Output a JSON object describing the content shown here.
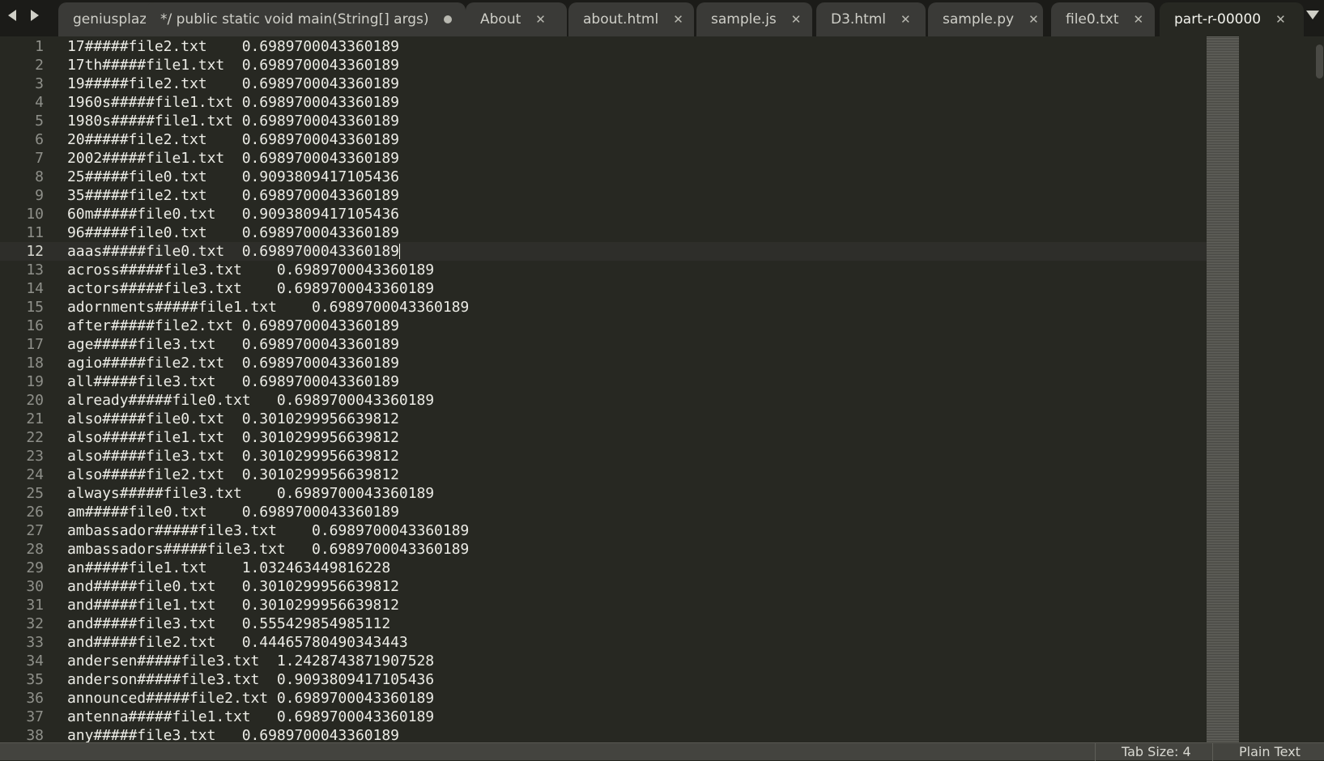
{
  "tabs": [
    {
      "label": "geniusplaz",
      "state": "truncated"
    },
    {
      "label": "*/    public static void main(String[] args)",
      "state": "modified"
    },
    {
      "label": "About",
      "state": "close"
    },
    {
      "label": "about.html",
      "state": "close"
    },
    {
      "label": "sample.js",
      "state": "close"
    },
    {
      "label": "D3.html",
      "state": "close"
    },
    {
      "label": "sample.py",
      "state": "close"
    },
    {
      "label": "file0.txt",
      "state": "close"
    },
    {
      "label": "part-r-00000",
      "state": "close",
      "active": true
    }
  ],
  "icons": {
    "back": "chevron-left-icon",
    "forward": "chevron-right-icon",
    "close": "close-icon",
    "modified": "unsaved-dot-icon",
    "tab_list": "chevron-down-icon"
  },
  "editor": {
    "current_line": 12,
    "lines": [
      "17#####file2.txt    0.6989700043360189",
      "17th#####file1.txt  0.6989700043360189",
      "19#####file2.txt    0.6989700043360189",
      "1960s#####file1.txt 0.6989700043360189",
      "1980s#####file1.txt 0.6989700043360189",
      "20#####file2.txt    0.6989700043360189",
      "2002#####file1.txt  0.6989700043360189",
      "25#####file0.txt    0.9093809417105436",
      "35#####file2.txt    0.6989700043360189",
      "60m#####file0.txt   0.9093809417105436",
      "96#####file0.txt    0.6989700043360189",
      "aaas#####file0.txt  0.6989700043360189",
      "across#####file3.txt    0.6989700043360189",
      "actors#####file3.txt    0.6989700043360189",
      "adornments#####file1.txt    0.6989700043360189",
      "after#####file2.txt 0.6989700043360189",
      "age#####file3.txt   0.6989700043360189",
      "agio#####file2.txt  0.6989700043360189",
      "all#####file3.txt   0.6989700043360189",
      "already#####file0.txt   0.6989700043360189",
      "also#####file0.txt  0.3010299956639812",
      "also#####file1.txt  0.3010299956639812",
      "also#####file3.txt  0.3010299956639812",
      "also#####file2.txt  0.3010299956639812",
      "always#####file3.txt    0.6989700043360189",
      "am#####file0.txt    0.6989700043360189",
      "ambassador#####file3.txt    0.6989700043360189",
      "ambassadors#####file3.txt   0.6989700043360189",
      "an#####file1.txt    1.032463449816228",
      "and#####file0.txt   0.3010299956639812",
      "and#####file1.txt   0.3010299956639812",
      "and#####file3.txt   0.555429854985112",
      "and#####file2.txt   0.44465780490343443",
      "andersen#####file3.txt  1.2428743871907528",
      "anderson#####file3.txt  0.9093809417105436",
      "announced#####file2.txt 0.6989700043360189",
      "antenna#####file1.txt   0.6989700043360189",
      "any#####file3.txt   0.6989700043360189"
    ]
  },
  "status": {
    "tab_size": "Tab Size: 4",
    "syntax": "Plain Text"
  }
}
